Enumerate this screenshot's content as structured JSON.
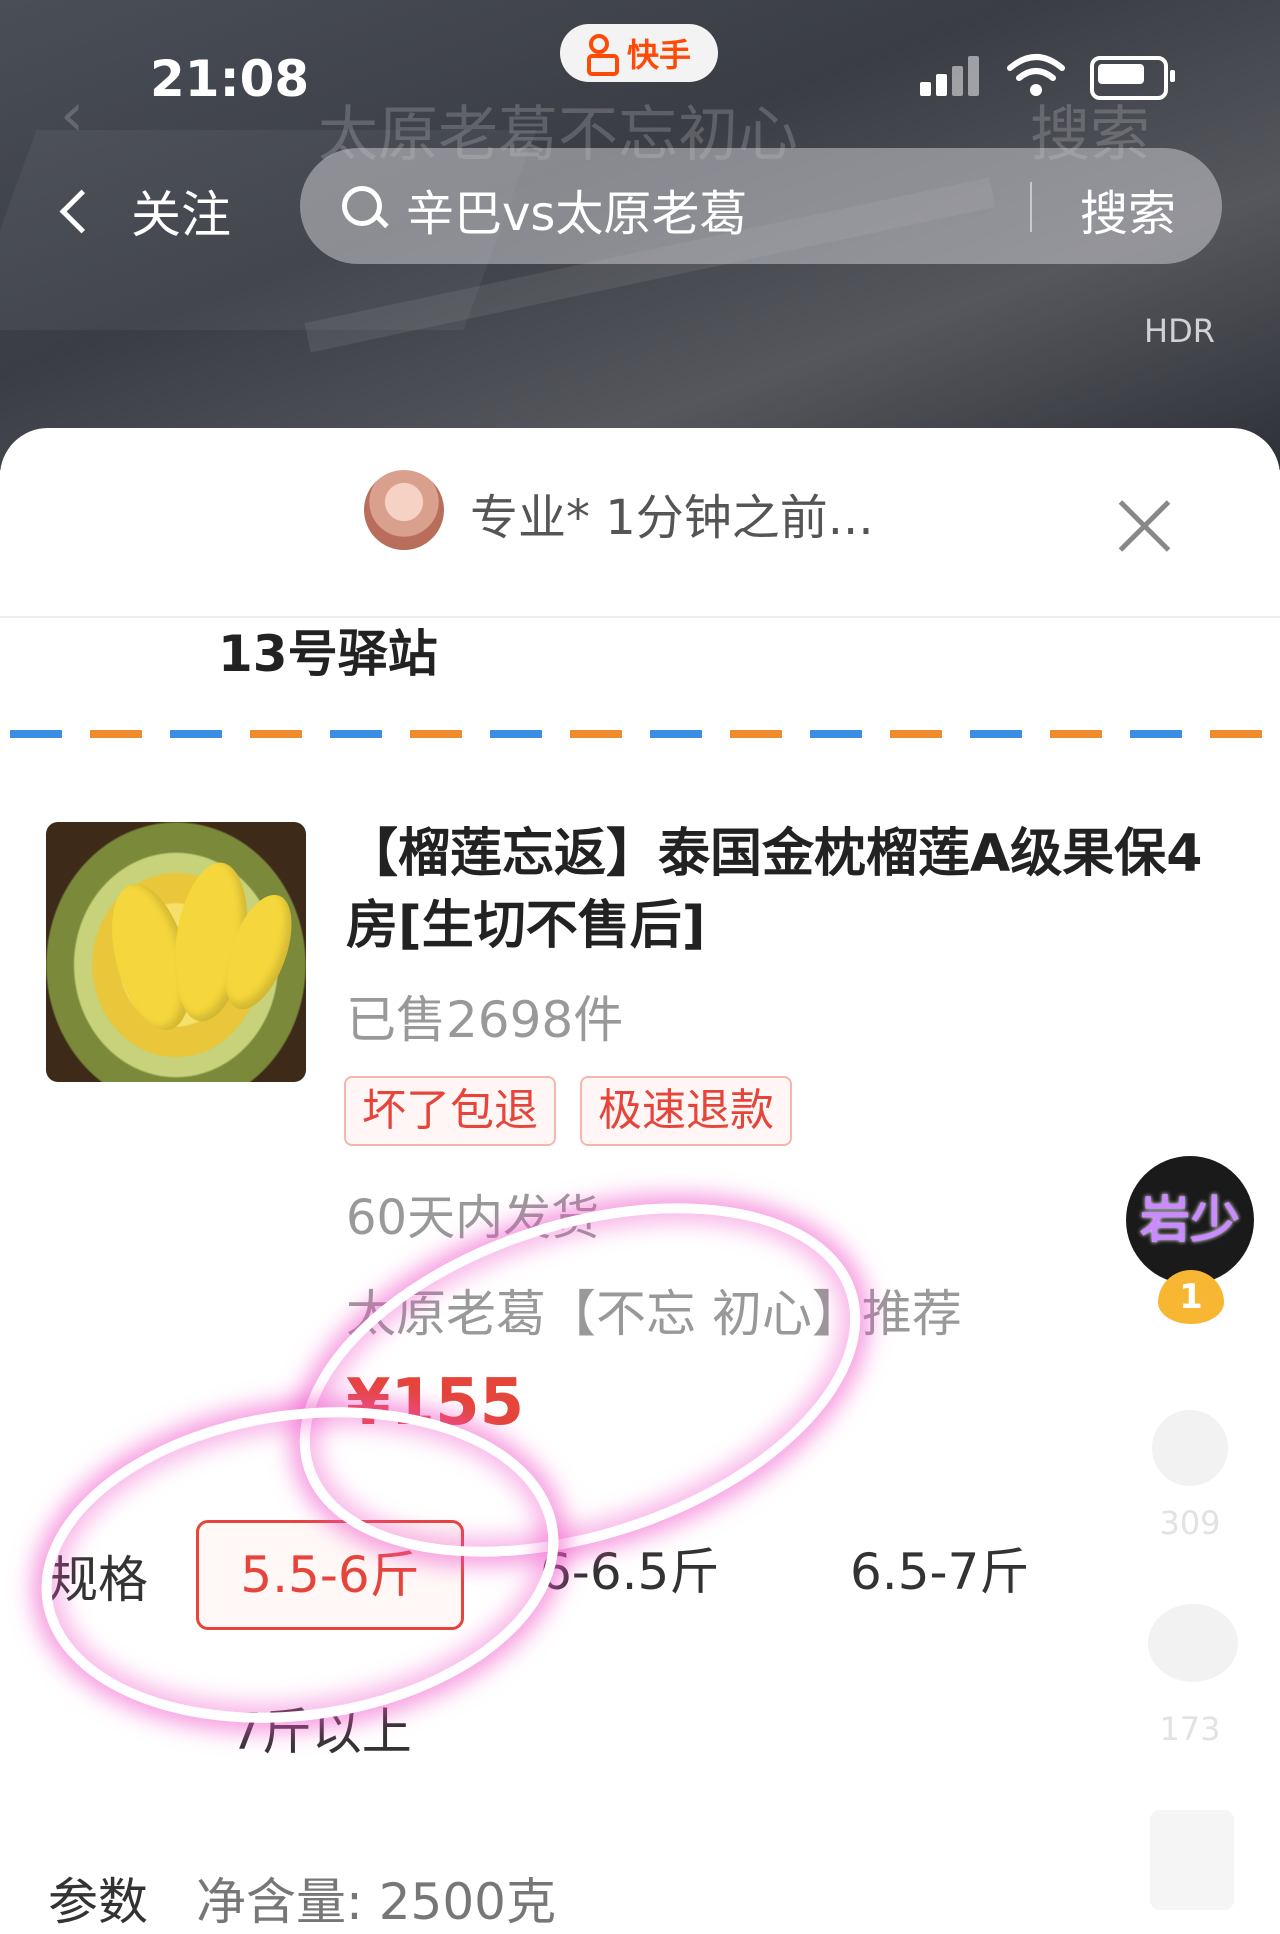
{
  "status_bar": {
    "time": "21:08",
    "app_badge": "快手"
  },
  "background": {
    "ghost_search": "太原老葛不忘初心",
    "ghost_button": "搜索"
  },
  "top_nav": {
    "back_label": "关注",
    "search_text": "辛巴vs太原老葛",
    "search_button": "搜索",
    "hdr": "HDR"
  },
  "sheet": {
    "header_text": "专业* 1分钟之前...",
    "station": "13号驿站",
    "product": {
      "title": "【榴莲忘返】泰国金枕榴莲A级果保4房[生切不售后]",
      "sold": "已售2698件",
      "tags": [
        "坏了包退",
        "极速退款"
      ],
      "shipping": "60天内发货",
      "recommend": "太原老葛【不忘 初心】推荐",
      "price": "¥155"
    },
    "spec": {
      "label": "规格",
      "options": [
        "5.5-6斤",
        "6-6.5斤",
        "6.5-7斤",
        "7斤以上"
      ],
      "selected": "5.5-6斤"
    },
    "params": {
      "label": "参数",
      "value": "净含量: 2500克"
    }
  },
  "side_rail": {
    "avatar_text": "岩少",
    "rank_badge": "1",
    "like_count": "309",
    "comment_count": "173"
  },
  "colors": {
    "accent": "#e5453a",
    "brand": "#ff4906",
    "highlight": "#f050c8"
  }
}
